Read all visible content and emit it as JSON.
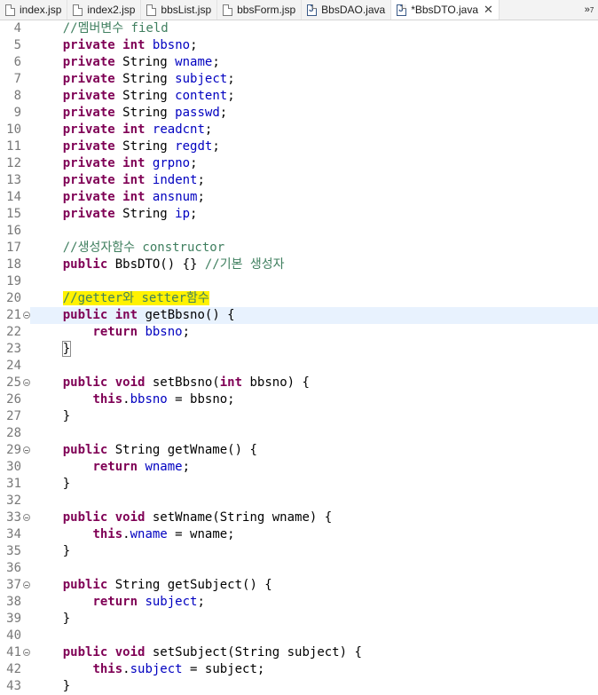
{
  "tabs": [
    {
      "label": "index.jsp",
      "type": "jsp",
      "active": false
    },
    {
      "label": "index2.jsp",
      "type": "jsp",
      "active": false
    },
    {
      "label": "bbsList.jsp",
      "type": "jsp",
      "active": false
    },
    {
      "label": "bbsForm.jsp",
      "type": "jsp",
      "active": false
    },
    {
      "label": "BbsDAO.java",
      "type": "java",
      "active": false
    },
    {
      "label": "*BbsDTO.java",
      "type": "java",
      "active": true
    }
  ],
  "overflow_count": "7",
  "current_line": 21,
  "colors": {
    "keyword": "#7f0055",
    "field": "#0000c0",
    "comment": "#3f7f5f",
    "highlight": "#fff200",
    "current_line": "#e8f2fe"
  },
  "lines": [
    {
      "n": 4,
      "tokens": [
        [
          "t",
          "    "
        ],
        [
          "c",
          "//멤버변수 field"
        ]
      ]
    },
    {
      "n": 5,
      "tokens": [
        [
          "t",
          "    "
        ],
        [
          "k",
          "private"
        ],
        [
          "t",
          " "
        ],
        [
          "k",
          "int"
        ],
        [
          "t",
          " "
        ],
        [
          "f",
          "bbsno"
        ],
        [
          "t",
          ";"
        ]
      ]
    },
    {
      "n": 6,
      "tokens": [
        [
          "t",
          "    "
        ],
        [
          "k",
          "private"
        ],
        [
          "t",
          " String "
        ],
        [
          "f",
          "wname"
        ],
        [
          "t",
          ";"
        ]
      ]
    },
    {
      "n": 7,
      "tokens": [
        [
          "t",
          "    "
        ],
        [
          "k",
          "private"
        ],
        [
          "t",
          " String "
        ],
        [
          "f",
          "subject"
        ],
        [
          "t",
          ";"
        ]
      ]
    },
    {
      "n": 8,
      "tokens": [
        [
          "t",
          "    "
        ],
        [
          "k",
          "private"
        ],
        [
          "t",
          " String "
        ],
        [
          "f",
          "content"
        ],
        [
          "t",
          ";"
        ]
      ]
    },
    {
      "n": 9,
      "tokens": [
        [
          "t",
          "    "
        ],
        [
          "k",
          "private"
        ],
        [
          "t",
          " String "
        ],
        [
          "f",
          "passwd"
        ],
        [
          "t",
          ";"
        ]
      ]
    },
    {
      "n": 10,
      "tokens": [
        [
          "t",
          "    "
        ],
        [
          "k",
          "private"
        ],
        [
          "t",
          " "
        ],
        [
          "k",
          "int"
        ],
        [
          "t",
          " "
        ],
        [
          "f",
          "readcnt"
        ],
        [
          "t",
          ";"
        ]
      ]
    },
    {
      "n": 11,
      "tokens": [
        [
          "t",
          "    "
        ],
        [
          "k",
          "private"
        ],
        [
          "t",
          " String "
        ],
        [
          "f",
          "regdt"
        ],
        [
          "t",
          ";"
        ]
      ]
    },
    {
      "n": 12,
      "tokens": [
        [
          "t",
          "    "
        ],
        [
          "k",
          "private"
        ],
        [
          "t",
          " "
        ],
        [
          "k",
          "int"
        ],
        [
          "t",
          " "
        ],
        [
          "f",
          "grpno"
        ],
        [
          "t",
          ";"
        ]
      ]
    },
    {
      "n": 13,
      "tokens": [
        [
          "t",
          "    "
        ],
        [
          "k",
          "private"
        ],
        [
          "t",
          " "
        ],
        [
          "k",
          "int"
        ],
        [
          "t",
          " "
        ],
        [
          "f",
          "indent"
        ],
        [
          "t",
          ";"
        ]
      ]
    },
    {
      "n": 14,
      "tokens": [
        [
          "t",
          "    "
        ],
        [
          "k",
          "private"
        ],
        [
          "t",
          " "
        ],
        [
          "k",
          "int"
        ],
        [
          "t",
          " "
        ],
        [
          "f",
          "ansnum"
        ],
        [
          "t",
          ";"
        ]
      ]
    },
    {
      "n": 15,
      "tokens": [
        [
          "t",
          "    "
        ],
        [
          "k",
          "private"
        ],
        [
          "t",
          " String "
        ],
        [
          "f",
          "ip"
        ],
        [
          "t",
          ";"
        ]
      ]
    },
    {
      "n": 16,
      "tokens": []
    },
    {
      "n": 17,
      "tokens": [
        [
          "t",
          "    "
        ],
        [
          "c",
          "//생성자함수 constructor"
        ]
      ]
    },
    {
      "n": 18,
      "tokens": [
        [
          "t",
          "    "
        ],
        [
          "k",
          "public"
        ],
        [
          "t",
          " BbsDTO() {} "
        ],
        [
          "c",
          "//기본 생성자"
        ]
      ]
    },
    {
      "n": 19,
      "tokens": []
    },
    {
      "n": 20,
      "tokens": [
        [
          "t",
          "    "
        ],
        [
          "h",
          "//getter와 setter함수"
        ]
      ]
    },
    {
      "n": 21,
      "fold": true,
      "tokens": [
        [
          "t",
          "    "
        ],
        [
          "k",
          "public"
        ],
        [
          "t",
          " "
        ],
        [
          "k",
          "int"
        ],
        [
          "t",
          " getBbsno() {"
        ]
      ]
    },
    {
      "n": 22,
      "tokens": [
        [
          "t",
          "        "
        ],
        [
          "k",
          "return"
        ],
        [
          "t",
          " "
        ],
        [
          "f",
          "bbsno"
        ],
        [
          "t",
          ";"
        ]
      ]
    },
    {
      "n": 23,
      "tokens": [
        [
          "t",
          "    "
        ],
        [
          "b",
          "}"
        ]
      ]
    },
    {
      "n": 24,
      "tokens": []
    },
    {
      "n": 25,
      "fold": true,
      "tokens": [
        [
          "t",
          "    "
        ],
        [
          "k",
          "public"
        ],
        [
          "t",
          " "
        ],
        [
          "k",
          "void"
        ],
        [
          "t",
          " setBbsno("
        ],
        [
          "k",
          "int"
        ],
        [
          "t",
          " bbsno) {"
        ]
      ]
    },
    {
      "n": 26,
      "tokens": [
        [
          "t",
          "        "
        ],
        [
          "k",
          "this"
        ],
        [
          "t",
          "."
        ],
        [
          "f",
          "bbsno"
        ],
        [
          "t",
          " = bbsno;"
        ]
      ]
    },
    {
      "n": 27,
      "tokens": [
        [
          "t",
          "    }"
        ]
      ]
    },
    {
      "n": 28,
      "tokens": []
    },
    {
      "n": 29,
      "fold": true,
      "tokens": [
        [
          "t",
          "    "
        ],
        [
          "k",
          "public"
        ],
        [
          "t",
          " String getWname() {"
        ]
      ]
    },
    {
      "n": 30,
      "tokens": [
        [
          "t",
          "        "
        ],
        [
          "k",
          "return"
        ],
        [
          "t",
          " "
        ],
        [
          "f",
          "wname"
        ],
        [
          "t",
          ";"
        ]
      ]
    },
    {
      "n": 31,
      "tokens": [
        [
          "t",
          "    }"
        ]
      ]
    },
    {
      "n": 32,
      "tokens": []
    },
    {
      "n": 33,
      "fold": true,
      "tokens": [
        [
          "t",
          "    "
        ],
        [
          "k",
          "public"
        ],
        [
          "t",
          " "
        ],
        [
          "k",
          "void"
        ],
        [
          "t",
          " setWname(String wname) {"
        ]
      ]
    },
    {
      "n": 34,
      "tokens": [
        [
          "t",
          "        "
        ],
        [
          "k",
          "this"
        ],
        [
          "t",
          "."
        ],
        [
          "f",
          "wname"
        ],
        [
          "t",
          " = wname;"
        ]
      ]
    },
    {
      "n": 35,
      "tokens": [
        [
          "t",
          "    }"
        ]
      ]
    },
    {
      "n": 36,
      "tokens": []
    },
    {
      "n": 37,
      "fold": true,
      "tokens": [
        [
          "t",
          "    "
        ],
        [
          "k",
          "public"
        ],
        [
          "t",
          " String getSubject() {"
        ]
      ]
    },
    {
      "n": 38,
      "tokens": [
        [
          "t",
          "        "
        ],
        [
          "k",
          "return"
        ],
        [
          "t",
          " "
        ],
        [
          "f",
          "subject"
        ],
        [
          "t",
          ";"
        ]
      ]
    },
    {
      "n": 39,
      "tokens": [
        [
          "t",
          "    }"
        ]
      ]
    },
    {
      "n": 40,
      "tokens": []
    },
    {
      "n": 41,
      "fold": true,
      "tokens": [
        [
          "t",
          "    "
        ],
        [
          "k",
          "public"
        ],
        [
          "t",
          " "
        ],
        [
          "k",
          "void"
        ],
        [
          "t",
          " setSubject(String subject) {"
        ]
      ]
    },
    {
      "n": 42,
      "tokens": [
        [
          "t",
          "        "
        ],
        [
          "k",
          "this"
        ],
        [
          "t",
          "."
        ],
        [
          "f",
          "subject"
        ],
        [
          "t",
          " = subject;"
        ]
      ]
    },
    {
      "n": 43,
      "tokens": [
        [
          "t",
          "    }"
        ]
      ]
    }
  ]
}
